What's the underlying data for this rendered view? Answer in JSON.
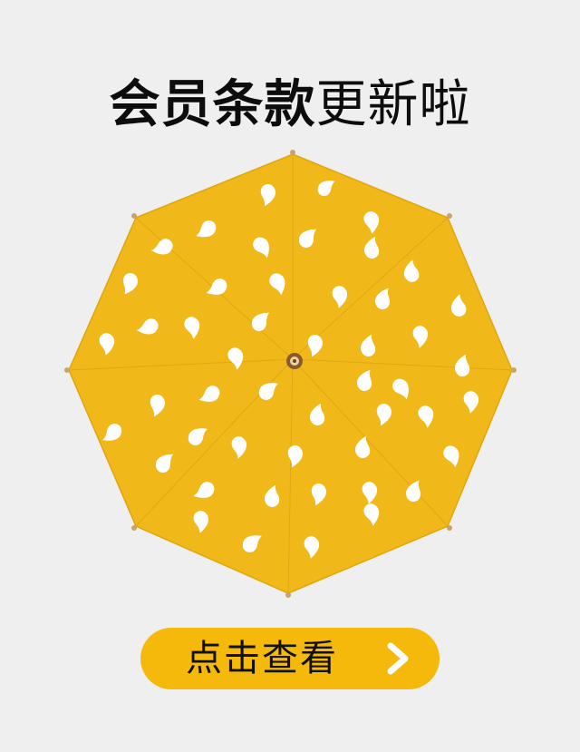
{
  "headline": {
    "bold_text": "会员条款",
    "light_text": "更新啦"
  },
  "cta": {
    "label": "点击查看",
    "icon": "chevron-right-icon"
  },
  "image": {
    "subject": "umbrella-image",
    "canopy_color": "#f1b81a",
    "pattern_color": "#ffffff"
  },
  "colors": {
    "background": "#efefef",
    "button": "#f5b90c",
    "text": "#111111"
  }
}
